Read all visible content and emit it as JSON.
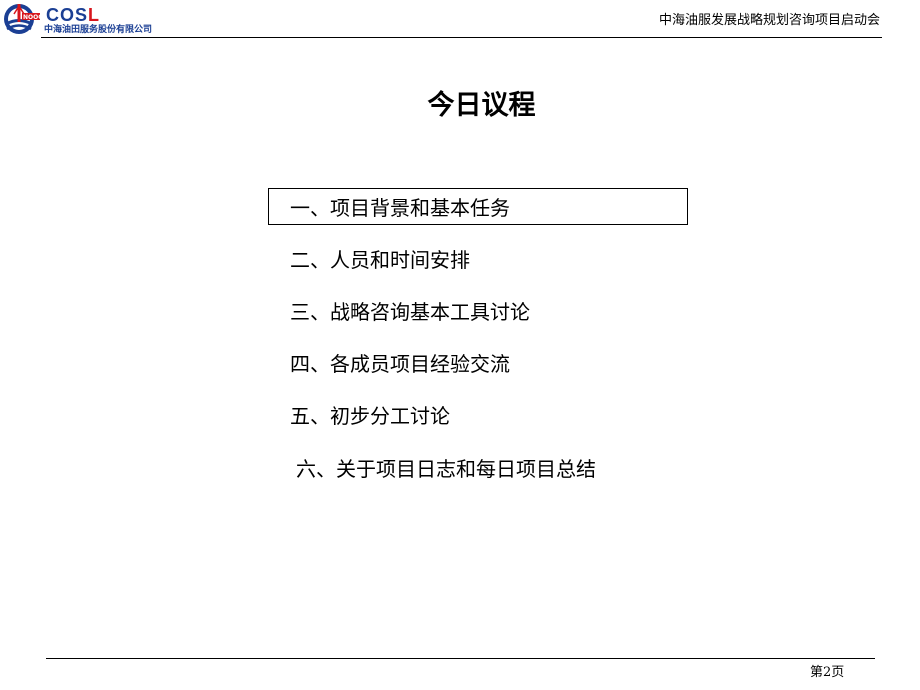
{
  "header": {
    "logo": {
      "brand_main": "COS",
      "brand_accent": "L",
      "company_name": "中海油田服务股份有限公司",
      "emblem_icon": "cnooc-emblem-icon",
      "brand_color": "#1b3f94",
      "accent_color": "#d7161d"
    },
    "title": "中海油服发展战略规划咨询项目启动会"
  },
  "slide": {
    "title": "今日议程",
    "agenda": [
      {
        "label": "一、项目背景和基本任务",
        "highlighted": true
      },
      {
        "label": "二、人员和时间安排",
        "highlighted": false
      },
      {
        "label": "三、战略咨询基本工具讨论",
        "highlighted": false
      },
      {
        "label": "四、各成员项目经验交流",
        "highlighted": false
      },
      {
        "label": "五、初步分工讨论",
        "highlighted": false
      },
      {
        "label": "六、关于项目日志和每日项目总结",
        "highlighted": false
      }
    ]
  },
  "footer": {
    "page_label": "第2页"
  }
}
